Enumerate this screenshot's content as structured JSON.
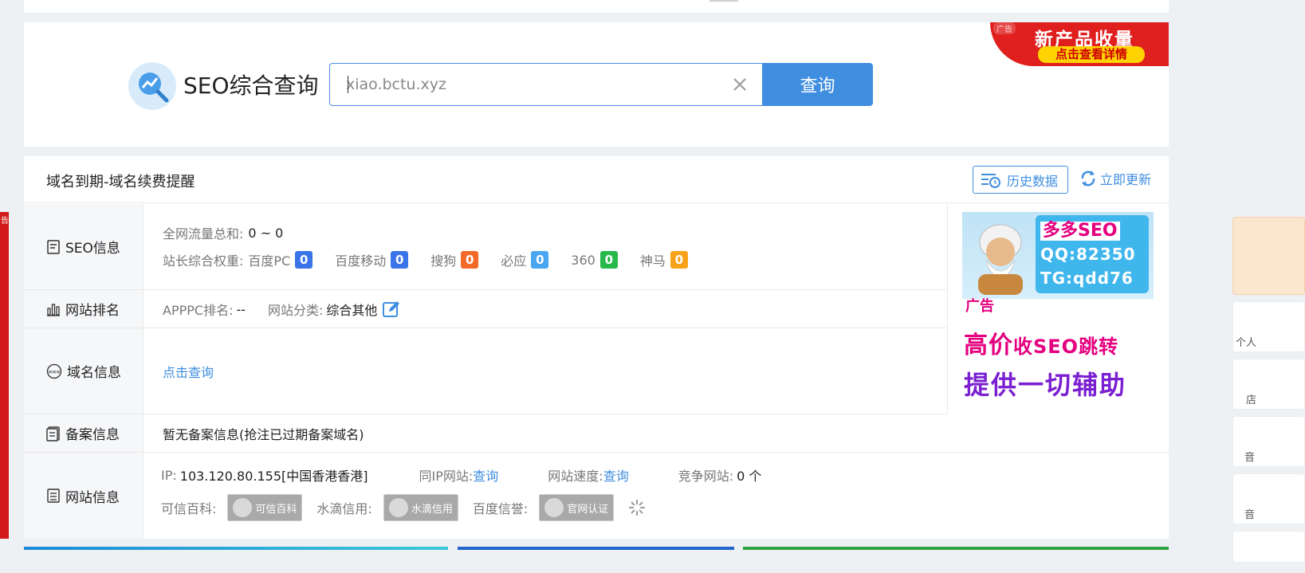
{
  "search": {
    "title": "SEO综合查询",
    "input_value": "xiao.bctu.xyz",
    "button_label": "查询"
  },
  "top_ad": {
    "tag": "广告",
    "headline": "新产品收量",
    "sub": "点击查看详情"
  },
  "card": {
    "title": "域名到期-域名续费提醒",
    "history_label": "历史数据",
    "refresh_label": "立即更新"
  },
  "seo": {
    "label": "SEO信息",
    "traffic_label": "全网流量总和:",
    "traffic_value": "0 ~ 0",
    "weight_label": "站长综合权重:",
    "weights": [
      {
        "name": "百度PC",
        "value": "0",
        "color": "#3b73e8"
      },
      {
        "name": "百度移动",
        "value": "0",
        "color": "#3b73e8"
      },
      {
        "name": "搜狗",
        "value": "0",
        "color": "#f26a2a"
      },
      {
        "name": "必应",
        "value": "0",
        "color": "#4aa6f0"
      },
      {
        "name": "360",
        "value": "0",
        "color": "#27b94c"
      },
      {
        "name": "神马",
        "value": "0",
        "color": "#f7a21b"
      }
    ]
  },
  "ranking": {
    "label": "网站排名",
    "apppc_label": "APPPC排名:",
    "apppc_value": "--",
    "category_label": "网站分类:",
    "category_value": "综合其他"
  },
  "domain": {
    "label": "域名信息",
    "link": "点击查询"
  },
  "beian": {
    "label": "备案信息",
    "value": "暂无备案信息(抢注已过期备案域名)"
  },
  "site": {
    "label": "网站信息",
    "ip_label": "IP:",
    "ip_value": "103.120.80.155[中国香港香港]",
    "same_ip_label": "同IP网站:",
    "same_ip_link": "查询",
    "speed_label": "网站速度:",
    "speed_link": "查询",
    "compete_label": "竞争网站:",
    "compete_value": "0 个",
    "kexin_label": "可信百科:",
    "kexin_badge": "可信百科",
    "shuidi_label": "水滴信用:",
    "shuidi_badge": "水滴信用",
    "baidu_label": "百度信誉:",
    "baidu_badge": "官网认证"
  },
  "right_ad": {
    "line1": "多多SEO",
    "line2": "QQ:82350",
    "line3": "TG:qdd76",
    "tag": "广告",
    "big1a": "高价",
    "big1b": "收SEO跳转",
    "big2": "提供一切辅助"
  },
  "left_edge": {
    "tag": "告"
  },
  "right_side": {
    "frag1": "个人",
    "frag2": "店",
    "frag3": "音",
    "frag4": "音"
  },
  "colors": {
    "accent": "#3f8ee0",
    "ad_red": "#e01f1f"
  }
}
